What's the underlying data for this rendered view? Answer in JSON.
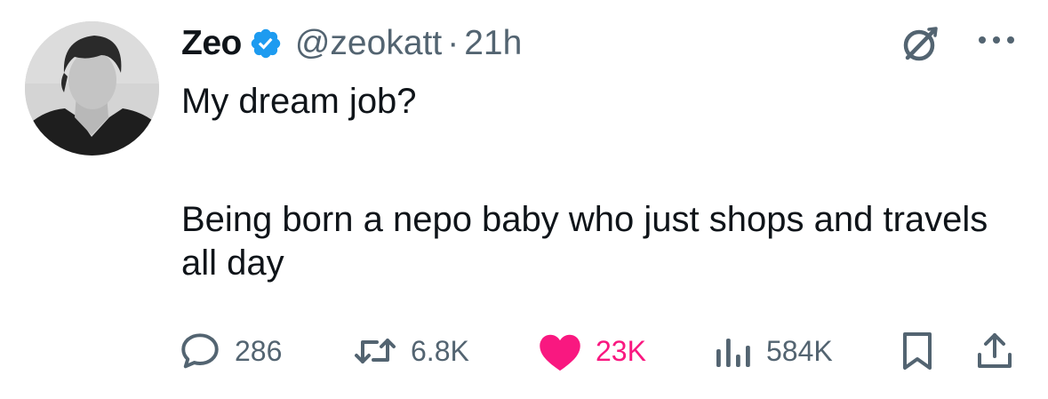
{
  "author": {
    "name": "Zeo",
    "handle": "@zeokatt",
    "separator": "·",
    "time": "21h"
  },
  "tweet": {
    "lines": [
      "My dream job?",
      "Being born a nepo baby who just shops and travels all day"
    ]
  },
  "actions": {
    "replies": "286",
    "reposts": "6.8K",
    "likes": "23K",
    "views": "584K"
  },
  "colors": {
    "verified_blue": "#1d9bf0",
    "like_pink": "#f91880",
    "secondary_text": "#536471",
    "primary_text": "#0f1419"
  },
  "icons": [
    "verified-badge-icon",
    "grok-icon",
    "more-icon",
    "reply-icon",
    "repost-icon",
    "like-icon",
    "views-icon",
    "bookmark-icon",
    "share-icon"
  ]
}
